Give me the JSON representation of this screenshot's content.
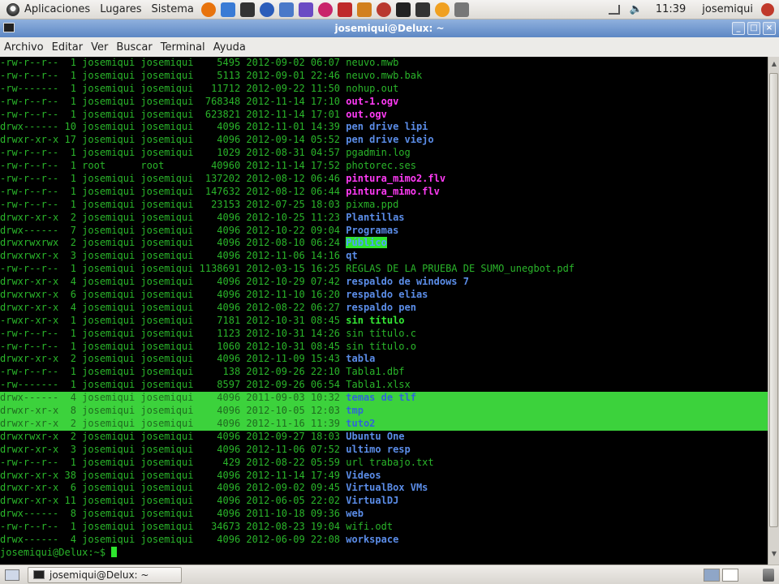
{
  "panel": {
    "menus": [
      "Aplicaciones",
      "Lugares",
      "Sistema"
    ],
    "launchers": [
      {
        "icon": "firefox-icon",
        "color": "#e8730c"
      },
      {
        "icon": "evolution-icon",
        "color": "#3a7bd5"
      },
      {
        "icon": "terminal-icon",
        "color": "#333333"
      },
      {
        "icon": "tools-icon",
        "color": "#2a5cba"
      },
      {
        "icon": "hexagon-icon",
        "color": "#4a79c9"
      },
      {
        "icon": "circle-icon",
        "color": "#6a4bc4"
      },
      {
        "icon": "p-icon",
        "color": "#c9246b"
      },
      {
        "icon": "media-icon",
        "color": "#bf2a2a"
      },
      {
        "icon": "fox-icon",
        "color": "#d2801e"
      },
      {
        "icon": "paw-icon",
        "color": "#b9392f"
      },
      {
        "icon": "penguin-icon",
        "color": "#222222"
      },
      {
        "icon": "tux-icon",
        "color": "#333333"
      },
      {
        "icon": "flag-icon",
        "color": "#f0a020"
      },
      {
        "icon": "pen-icon",
        "color": "#777777"
      }
    ],
    "clock": "11:39",
    "user": "josemiqui"
  },
  "window": {
    "title": "josemiqui@Delux: ~",
    "menu": [
      {
        "label": "Archivo"
      },
      {
        "label": "Editar"
      },
      {
        "label": "Ver"
      },
      {
        "label": "Buscar"
      },
      {
        "label": "Terminal"
      },
      {
        "label": "Ayuda"
      }
    ]
  },
  "terminal": {
    "lines": [
      {
        "perm": "-rw-r--r--",
        "links": "1",
        "owner": "josemiqui",
        "group": "josemiqui",
        "size": "5495",
        "date": "2012-09-02",
        "time": "06:07",
        "name": "neuvo.mwb",
        "type": "file"
      },
      {
        "perm": "-rw-r--r--",
        "links": "1",
        "owner": "josemiqui",
        "group": "josemiqui",
        "size": "5113",
        "date": "2012-09-01",
        "time": "22:46",
        "name": "neuvo.mwb.bak",
        "type": "file"
      },
      {
        "perm": "-rw-------",
        "links": "1",
        "owner": "josemiqui",
        "group": "josemiqui",
        "size": "11712",
        "date": "2012-09-22",
        "time": "11:50",
        "name": "nohup.out",
        "type": "file"
      },
      {
        "perm": "-rw-r--r--",
        "links": "1",
        "owner": "josemiqui",
        "group": "josemiqui",
        "size": "768348",
        "date": "2012-11-14",
        "time": "17:10",
        "name": "out-1.ogv",
        "type": "media"
      },
      {
        "perm": "-rw-r--r--",
        "links": "1",
        "owner": "josemiqui",
        "group": "josemiqui",
        "size": "623821",
        "date": "2012-11-14",
        "time": "17:01",
        "name": "out.ogv",
        "type": "media"
      },
      {
        "perm": "drwx------",
        "links": "10",
        "owner": "josemiqui",
        "group": "josemiqui",
        "size": "4096",
        "date": "2012-11-01",
        "time": "14:39",
        "name": "pen drive lipi",
        "type": "dir"
      },
      {
        "perm": "drwxr-xr-x",
        "links": "17",
        "owner": "josemiqui",
        "group": "josemiqui",
        "size": "4096",
        "date": "2012-09-14",
        "time": "05:52",
        "name": "pen drive viejo",
        "type": "dir"
      },
      {
        "perm": "-rw-r--r--",
        "links": "1",
        "owner": "josemiqui",
        "group": "josemiqui",
        "size": "1029",
        "date": "2012-08-31",
        "time": "04:57",
        "name": "pgadmin.log",
        "type": "file"
      },
      {
        "perm": "-rw-r--r--",
        "links": "1",
        "owner": "root",
        "group": "root",
        "size": "40960",
        "date": "2012-11-14",
        "time": "17:52",
        "name": "photorec.ses",
        "type": "file"
      },
      {
        "perm": "-rw-r--r--",
        "links": "1",
        "owner": "josemiqui",
        "group": "josemiqui",
        "size": "137202",
        "date": "2012-08-12",
        "time": "06:46",
        "name": "pintura_mimo2.flv",
        "type": "media"
      },
      {
        "perm": "-rw-r--r--",
        "links": "1",
        "owner": "josemiqui",
        "group": "josemiqui",
        "size": "147632",
        "date": "2012-08-12",
        "time": "06:44",
        "name": "pintura_mimo.flv",
        "type": "media"
      },
      {
        "perm": "-rw-r--r--",
        "links": "1",
        "owner": "josemiqui",
        "group": "josemiqui",
        "size": "23153",
        "date": "2012-07-25",
        "time": "18:03",
        "name": "pixma.ppd",
        "type": "file"
      },
      {
        "perm": "drwxr-xr-x",
        "links": "2",
        "owner": "josemiqui",
        "group": "josemiqui",
        "size": "4096",
        "date": "2012-10-25",
        "time": "11:23",
        "name": "Plantillas",
        "type": "dir"
      },
      {
        "perm": "drwx------",
        "links": "7",
        "owner": "josemiqui",
        "group": "josemiqui",
        "size": "4096",
        "date": "2012-10-22",
        "time": "09:04",
        "name": "Programas",
        "type": "dir"
      },
      {
        "perm": "drwxrwxrwx",
        "links": "2",
        "owner": "josemiqui",
        "group": "josemiqui",
        "size": "4096",
        "date": "2012-08-10",
        "time": "06:24",
        "name": "Público",
        "type": "ow"
      },
      {
        "perm": "drwxrwxr-x",
        "links": "3",
        "owner": "josemiqui",
        "group": "josemiqui",
        "size": "4096",
        "date": "2012-11-06",
        "time": "14:16",
        "name": "qt",
        "type": "dir"
      },
      {
        "perm": "-rw-r--r--",
        "links": "1",
        "owner": "josemiqui",
        "group": "josemiqui",
        "size": "1138691",
        "date": "2012-03-15",
        "time": "16:25",
        "name": "REGLAS DE LA PRUEBA DE SUMO_unegbot.pdf",
        "type": "file"
      },
      {
        "perm": "drwxr-xr-x",
        "links": "4",
        "owner": "josemiqui",
        "group": "josemiqui",
        "size": "4096",
        "date": "2012-10-29",
        "time": "07:42",
        "name": "respaldo de windows 7",
        "type": "dir"
      },
      {
        "perm": "drwxrwxr-x",
        "links": "6",
        "owner": "josemiqui",
        "group": "josemiqui",
        "size": "4096",
        "date": "2012-11-10",
        "time": "16:20",
        "name": "respaldo elias",
        "type": "dir"
      },
      {
        "perm": "drwxr-xr-x",
        "links": "4",
        "owner": "josemiqui",
        "group": "josemiqui",
        "size": "4096",
        "date": "2012-08-22",
        "time": "06:27",
        "name": "respaldo pen",
        "type": "dir"
      },
      {
        "perm": "-rwxr-xr-x",
        "links": "1",
        "owner": "josemiqui",
        "group": "josemiqui",
        "size": "7181",
        "date": "2012-10-31",
        "time": "08:45",
        "name": "sin título",
        "type": "exec"
      },
      {
        "perm": "-rw-r--r--",
        "links": "1",
        "owner": "josemiqui",
        "group": "josemiqui",
        "size": "1123",
        "date": "2012-10-31",
        "time": "14:26",
        "name": "sin título.c",
        "type": "file"
      },
      {
        "perm": "-rw-r--r--",
        "links": "1",
        "owner": "josemiqui",
        "group": "josemiqui",
        "size": "1060",
        "date": "2012-10-31",
        "time": "08:45",
        "name": "sin título.o",
        "type": "file"
      },
      {
        "perm": "drwxr-xr-x",
        "links": "2",
        "owner": "josemiqui",
        "group": "josemiqui",
        "size": "4096",
        "date": "2012-11-09",
        "time": "15:43",
        "name": "tabla",
        "type": "dir"
      },
      {
        "perm": "-rw-r--r--",
        "links": "1",
        "owner": "josemiqui",
        "group": "josemiqui",
        "size": "138",
        "date": "2012-09-26",
        "time": "22:10",
        "name": "Tabla1.dbf",
        "type": "file"
      },
      {
        "perm": "-rw-------",
        "links": "1",
        "owner": "josemiqui",
        "group": "josemiqui",
        "size": "8597",
        "date": "2012-09-26",
        "time": "06:54",
        "name": "Tabla1.xlsx",
        "type": "file"
      },
      {
        "perm": "drwx------",
        "links": "4",
        "owner": "josemiqui",
        "group": "josemiqui",
        "size": "4096",
        "date": "2011-09-03",
        "time": "10:32",
        "name": "temas de tlf",
        "type": "dir",
        "hl": true
      },
      {
        "perm": "drwxr-xr-x",
        "links": "8",
        "owner": "josemiqui",
        "group": "josemiqui",
        "size": "4096",
        "date": "2012-10-05",
        "time": "12:03",
        "name": "tmp",
        "type": "dir",
        "hl": true
      },
      {
        "perm": "drwxr-xr-x",
        "links": "2",
        "owner": "josemiqui",
        "group": "josemiqui",
        "size": "4096",
        "date": "2012-11-16",
        "time": "11:39",
        "name": "tuto2",
        "type": "dir",
        "hl": true
      },
      {
        "perm": "drwxrwxr-x",
        "links": "2",
        "owner": "josemiqui",
        "group": "josemiqui",
        "size": "4096",
        "date": "2012-09-27",
        "time": "18:03",
        "name": "Ubuntu One",
        "type": "dir"
      },
      {
        "perm": "drwxr-xr-x",
        "links": "3",
        "owner": "josemiqui",
        "group": "josemiqui",
        "size": "4096",
        "date": "2012-11-06",
        "time": "07:52",
        "name": "ultimo resp",
        "type": "dir"
      },
      {
        "perm": "-rw-r--r--",
        "links": "1",
        "owner": "josemiqui",
        "group": "josemiqui",
        "size": "429",
        "date": "2012-08-22",
        "time": "05:59",
        "name": "url trabajo.txt",
        "type": "file"
      },
      {
        "perm": "drwxr-xr-x",
        "links": "38",
        "owner": "josemiqui",
        "group": "josemiqui",
        "size": "4096",
        "date": "2012-11-14",
        "time": "17:49",
        "name": "Videos",
        "type": "dir"
      },
      {
        "perm": "drwxr-xr-x",
        "links": "6",
        "owner": "josemiqui",
        "group": "josemiqui",
        "size": "4096",
        "date": "2012-09-02",
        "time": "09:45",
        "name": "VirtualBox VMs",
        "type": "dir"
      },
      {
        "perm": "drwxr-xr-x",
        "links": "11",
        "owner": "josemiqui",
        "group": "josemiqui",
        "size": "4096",
        "date": "2012-06-05",
        "time": "22:02",
        "name": "VirtualDJ",
        "type": "dir"
      },
      {
        "perm": "drwx------",
        "links": "8",
        "owner": "josemiqui",
        "group": "josemiqui",
        "size": "4096",
        "date": "2011-10-18",
        "time": "09:36",
        "name": "web",
        "type": "dir"
      },
      {
        "perm": "-rw-r--r--",
        "links": "1",
        "owner": "josemiqui",
        "group": "josemiqui",
        "size": "34673",
        "date": "2012-08-23",
        "time": "19:04",
        "name": "wifi.odt",
        "type": "file"
      },
      {
        "perm": "drwx------",
        "links": "4",
        "owner": "josemiqui",
        "group": "josemiqui",
        "size": "4096",
        "date": "2012-06-09",
        "time": "22:08",
        "name": "workspace",
        "type": "dir"
      }
    ],
    "prompt": "josemiqui@Delux:~$"
  },
  "taskbar": {
    "task_label": "josemiqui@Delux: ~"
  }
}
